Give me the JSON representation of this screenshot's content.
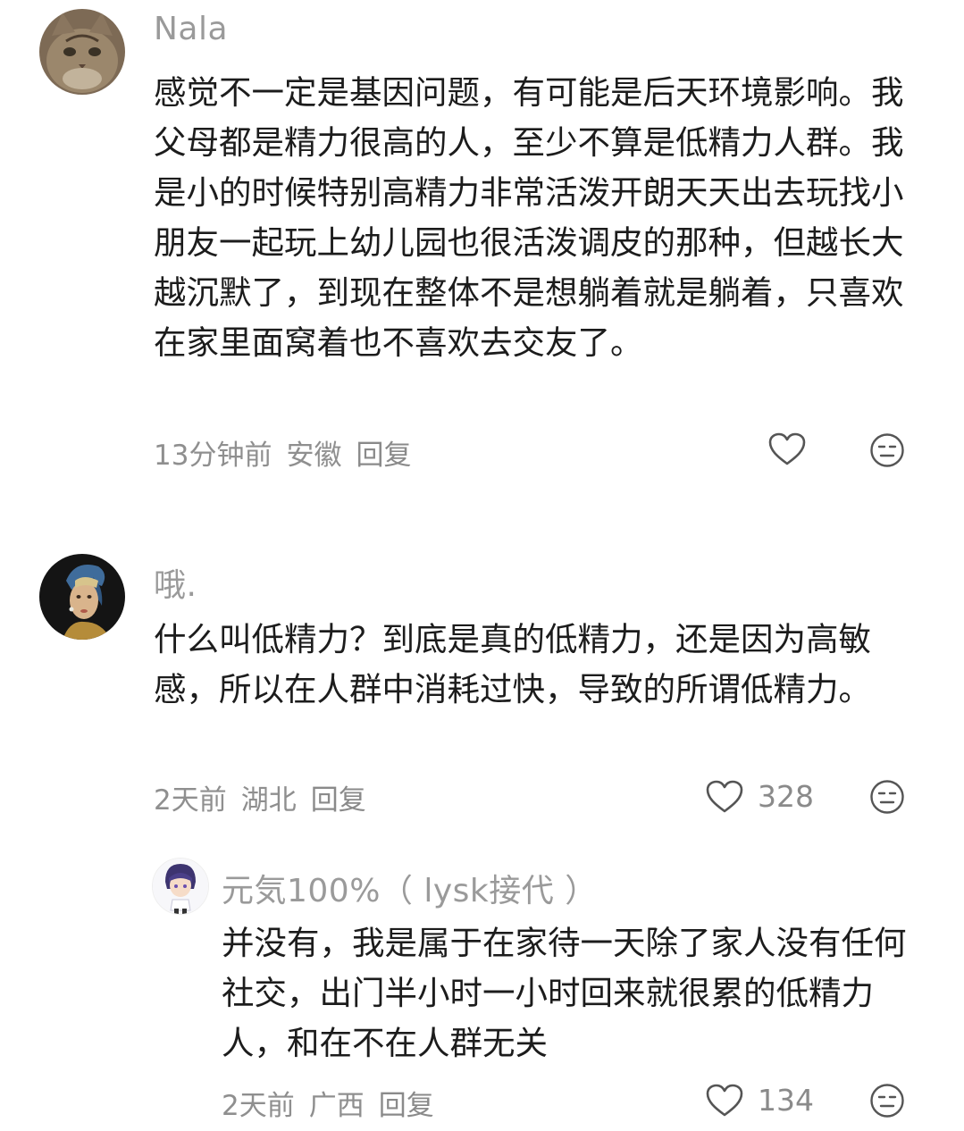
{
  "comments": [
    {
      "username": "Nala",
      "avatar": "cat-avatar",
      "text": "感觉不一定是基因问题，有可能是后天环境影响。我父母都是精力很高的人，至少不算是低精力人群。我是小的时候特别高精力非常活泼开朗天天出去玩找小朋友一起玩上幼儿园也很活泼调皮的那种，但越长大越沉默了，到现在整体不是想躺着就是躺着，只喜欢在家里面窝着也不喜欢去交友了。",
      "time": "13分钟前",
      "location": "安徽",
      "reply_label": "回复",
      "likes": ""
    },
    {
      "username": "哦.",
      "avatar": "girl-with-pearl-earring-avatar",
      "text": "什么叫低精力？到底是真的低精力，还是因为高敏感，所以在人群中消耗过快，导致的所谓低精力。",
      "time": "2天前",
      "location": "湖北",
      "reply_label": "回复",
      "likes": "328",
      "replies": [
        {
          "username": "元気100%（ lysk接代 ）",
          "avatar": "anime-boy-avatar",
          "text": "并没有，我是属于在家待一天除了家人没有任何社交，出门半小时一小时回来就很累的低精力人，和在不在人群无关",
          "time": "2天前",
          "location": "广西",
          "reply_label": "回复",
          "likes": "134"
        }
      ]
    }
  ]
}
